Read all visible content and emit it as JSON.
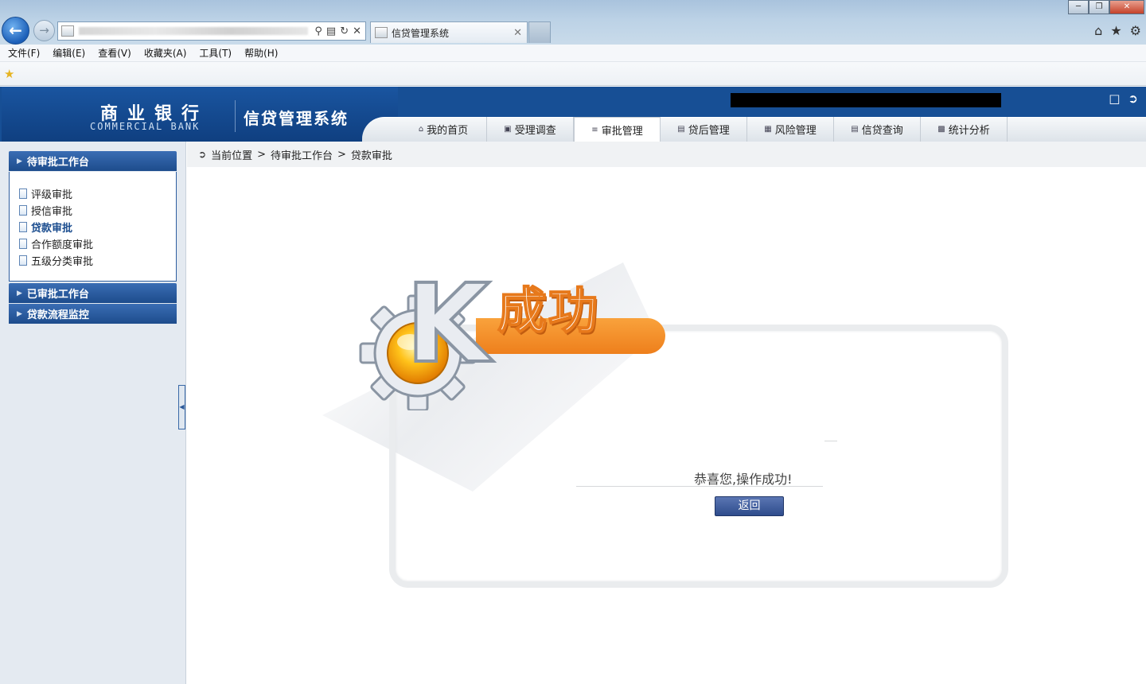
{
  "browser": {
    "tab_title": "信贷管理系统",
    "menu": [
      "文件(F)",
      "编辑(E)",
      "查看(V)",
      "收藏夹(A)",
      "工具(T)",
      "帮助(H)"
    ]
  },
  "header": {
    "bank_name_cn": "商业银行",
    "bank_name_en": "COMMERCIAL BANK",
    "system_name": "信贷管理系统",
    "nav": [
      "我的首页",
      "受理调查",
      "审批管理",
      "贷后管理",
      "风险管理",
      "信贷查询",
      "统计分析"
    ],
    "active_nav": "审批管理"
  },
  "sidebar": {
    "panels": [
      {
        "title": "待审批工作台",
        "expanded": true,
        "items": [
          "评级审批",
          "授信审批",
          "贷款审批",
          "合作额度审批",
          "五级分类审批"
        ],
        "active_item": "贷款审批"
      },
      {
        "title": "已审批工作台",
        "expanded": false
      },
      {
        "title": "贷款流程监控",
        "expanded": false
      }
    ]
  },
  "breadcrumb": {
    "label": "当前位置",
    "sep": ">",
    "path": [
      "待审批工作台",
      "贷款审批"
    ]
  },
  "result": {
    "title": "成功",
    "message": "恭喜您,操作成功!",
    "return_label": "返回"
  },
  "colors": {
    "brand_blue": "#174f95",
    "banner_orange": "#ee7f1c"
  },
  "icons": {
    "logo": "kde-gear-k-logo",
    "home": "home-icon",
    "star": "favorites-star-icon",
    "settings": "gear-icon"
  }
}
